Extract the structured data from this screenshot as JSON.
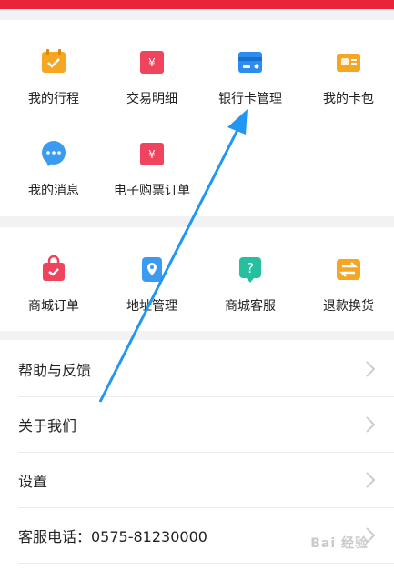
{
  "colors": {
    "accent": "#e8233a",
    "arrow": "#2196f3"
  },
  "grid1": [
    {
      "label": "我的行程",
      "icon": "calendar-icon"
    },
    {
      "label": "交易明细",
      "icon": "ticket-icon"
    },
    {
      "label": "银行卡管理",
      "icon": "bank-card-icon"
    },
    {
      "label": "我的卡包",
      "icon": "card-wallet-icon"
    },
    {
      "label": "我的消息",
      "icon": "message-icon"
    },
    {
      "label": "电子购票订单",
      "icon": "e-ticket-icon"
    }
  ],
  "grid2": [
    {
      "label": "商城订单",
      "icon": "shopping-bag-icon"
    },
    {
      "label": "地址管理",
      "icon": "location-icon"
    },
    {
      "label": "商城客服",
      "icon": "help-icon"
    },
    {
      "label": "退款换货",
      "icon": "refund-icon"
    }
  ],
  "rows": [
    {
      "label": "帮助与反馈"
    },
    {
      "label": "关于我们"
    },
    {
      "label": "设置"
    },
    {
      "label": "客服电话：0575-81230000"
    }
  ],
  "watermark": "Bai 经验"
}
